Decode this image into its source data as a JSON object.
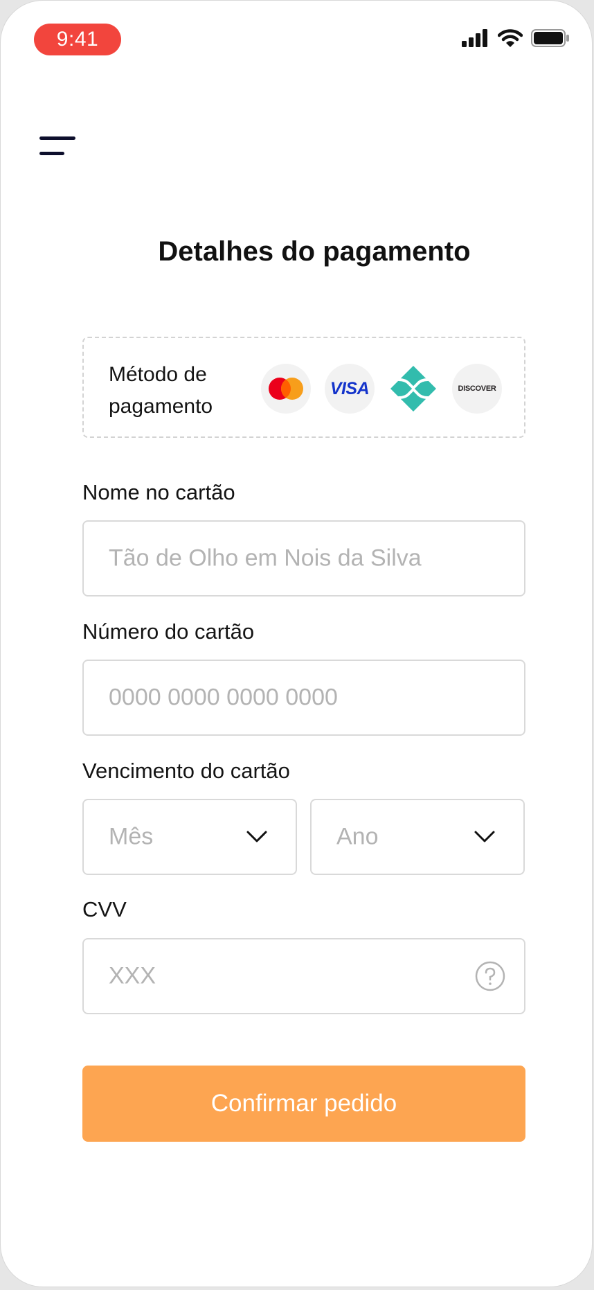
{
  "status_bar": {
    "time": "9:41"
  },
  "header": {
    "title": "Detalhes do pagamento"
  },
  "payment_method": {
    "label": "Método de pagamento",
    "brands": [
      {
        "name": "Mastercard",
        "icon": "mastercard-icon"
      },
      {
        "name": "VISA",
        "icon": "visa-icon"
      },
      {
        "name": "Pix",
        "icon": "pix-icon"
      },
      {
        "name": "DISCOVER",
        "icon": "discover-icon"
      }
    ]
  },
  "form": {
    "name_label": "Nome no cartão",
    "name_placeholder": "Tão de Olho em Nois da Silva",
    "number_label": "Número do cartão",
    "number_placeholder": "0000 0000 0000 0000",
    "expiry_label": "Vencimento do cartão",
    "month_placeholder": "Mês",
    "year_placeholder": "Ano",
    "cvv_label": "CVV",
    "cvv_placeholder": "XXX"
  },
  "actions": {
    "confirm_label": "Confirmar pedido"
  },
  "colors": {
    "accent": "#fda551",
    "time_pill": "#f2453d",
    "menu_icon": "#0d0f2c",
    "pix": "#32bcad",
    "visa": "#1434cb"
  }
}
